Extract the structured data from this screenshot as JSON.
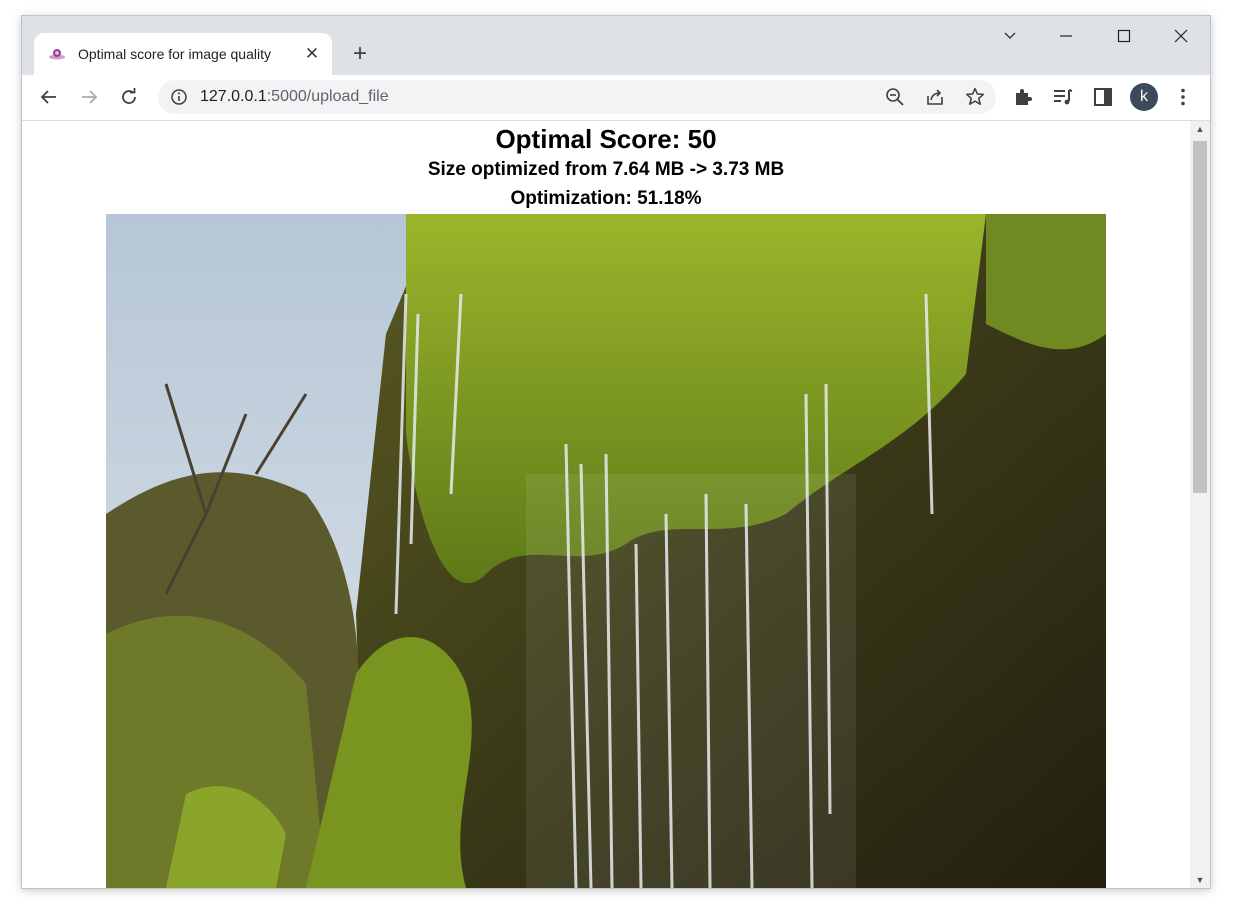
{
  "browser": {
    "tab_title": "Optimal score for image quality",
    "tab_close": "✕",
    "new_tab": "+",
    "url_host": "127.0.0.1",
    "url_rest": ":5000/upload_file",
    "profile_initial": "k"
  },
  "page": {
    "heading": "Optimal Score: 50",
    "size_line": "Size optimized from 7.64 MB -> 3.73 MB",
    "optimization_line": "Optimization: 51.18%"
  },
  "colors": {
    "tabstrip": "#dee1e6",
    "omnibox": "#f1f3f4",
    "avatar": "#3c4a5a"
  }
}
